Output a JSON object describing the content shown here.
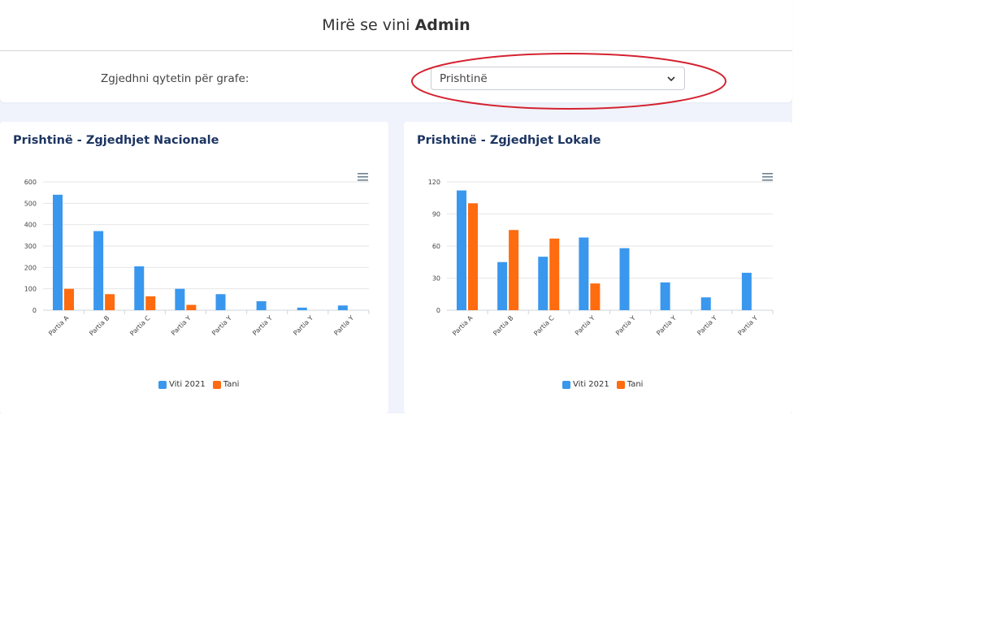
{
  "header": {
    "greeting": "Mirë se vini",
    "user": "Admin"
  },
  "filter": {
    "label": "Zgjedhni qytetin për grafe:",
    "selected_city": "Prishtinë"
  },
  "colors": {
    "series_2021": "#3a97ee",
    "series_now": "#ff6b0f",
    "title": "#1d3561",
    "highlight": "#d42230"
  },
  "icons": {
    "menu": "hamburger-menu-icon",
    "dropdown": "chevron-down-icon"
  },
  "charts": {
    "national": {
      "title": "Prishtinë - Zgjedhjet Nacionale"
    },
    "local": {
      "title": "Prishtinë - Zgjedhjet Lokale"
    },
    "legend_2021": "Viti 2021",
    "legend_now": "Tani"
  },
  "chart_data": [
    {
      "type": "bar",
      "title": "Prishtinë - Zgjedhjet Nacionale",
      "categories": [
        "Partia A",
        "Partia B",
        "Partia C",
        "Partia Y",
        "Partia Y",
        "Partia Y",
        "Partia Y",
        "Partia Y"
      ],
      "series": [
        {
          "name": "Viti 2021",
          "values": [
            540,
            370,
            205,
            100,
            75,
            42,
            12,
            22
          ]
        },
        {
          "name": "Tani",
          "values": [
            100,
            75,
            65,
            25,
            null,
            null,
            null,
            null
          ]
        }
      ],
      "yticks": [
        0,
        100,
        200,
        300,
        400,
        500,
        600
      ],
      "ylim": [
        0,
        600
      ],
      "grid": true,
      "legend": "bottom"
    },
    {
      "type": "bar",
      "title": "Prishtinë - Zgjedhjet Lokale",
      "categories": [
        "Partia A",
        "Partia B",
        "Partia C",
        "Partia Y",
        "Partia Y",
        "Partia Y",
        "Partia Y",
        "Partia Y"
      ],
      "series": [
        {
          "name": "Viti 2021",
          "values": [
            112,
            45,
            50,
            68,
            58,
            26,
            12,
            35
          ]
        },
        {
          "name": "Tani",
          "values": [
            100,
            75,
            67,
            25,
            null,
            null,
            null,
            null
          ]
        }
      ],
      "yticks": [
        0,
        30,
        60,
        90,
        120
      ],
      "ylim": [
        0,
        120
      ],
      "grid": true,
      "legend": "bottom"
    }
  ]
}
